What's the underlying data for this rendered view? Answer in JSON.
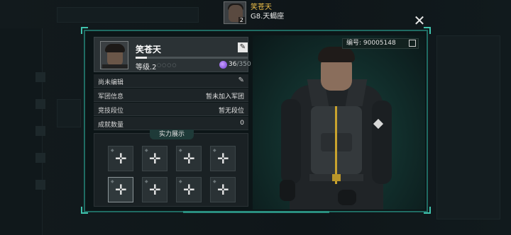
{
  "top_player": {
    "name": "笑苍天",
    "server": "G8.天蝎座",
    "avatar_level": "2"
  },
  "profile": {
    "name": "笑苍天",
    "level_text": "等级.2",
    "level_dots": "○○○○",
    "energy_current": "36",
    "energy_max": "/350",
    "xp_fraction": 0.1
  },
  "id_tag": {
    "label": "编号: 90005148"
  },
  "info_rows": [
    {
      "label": "尚未编辑",
      "value": ""
    },
    {
      "label": "军团信息",
      "value": "暂未加入军团"
    },
    {
      "label": "竞技段位",
      "value": "暂无段位"
    },
    {
      "label": "成就数量",
      "value": "0"
    }
  ],
  "power_display": {
    "title": "实力展示",
    "slots": [
      {
        "icon": "plus-icon"
      },
      {
        "icon": "plus-icon"
      },
      {
        "icon": "plus-icon"
      },
      {
        "icon": "plus-icon"
      },
      {
        "icon": "plus-icon"
      },
      {
        "icon": "plus-icon"
      },
      {
        "icon": "plus-icon"
      },
      {
        "icon": "plus-icon"
      }
    ]
  },
  "icons": {
    "close": "close-icon",
    "edit": "edit-icon",
    "energy": "energy-orb-icon",
    "copy": "copy-icon"
  },
  "colors": {
    "accent_teal": "#1f6b62",
    "name_gold": "#f3c24a",
    "energy_purple": "#6e3bd1"
  }
}
